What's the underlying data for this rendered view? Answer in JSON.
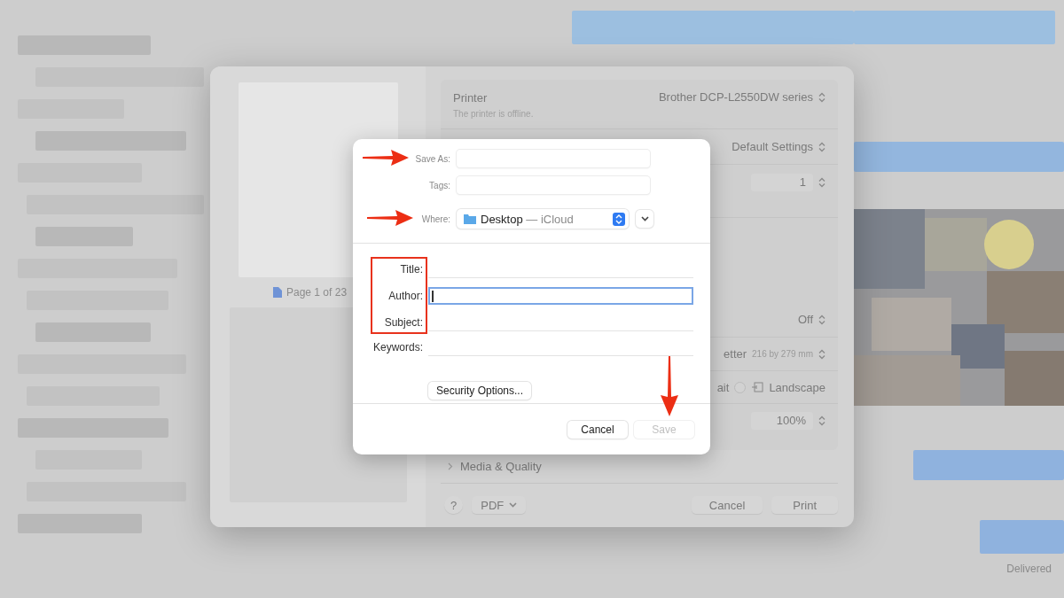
{
  "print_dialog": {
    "preview": {
      "page_label": "Page 1 of 23"
    },
    "printer": {
      "label": "Printer",
      "value": "Brother DCP-L2550DW series",
      "status": "The printer is offline."
    },
    "presets": {
      "value": "Default Settings"
    },
    "copies": {
      "value": "1"
    },
    "settings_rows": [
      {
        "kind": "popup",
        "value": "Off"
      },
      {
        "kind": "paper",
        "value": "etter",
        "detail": "216 by 279 mm"
      },
      {
        "kind": "orientation",
        "portrait_label": "ait",
        "landscape": {
          "label": "Landscape",
          "selected": false
        }
      },
      {
        "kind": "stepper",
        "value": "100%"
      }
    ],
    "section": {
      "label": "Media & Quality",
      "expanded": false
    },
    "help_button": "?",
    "pdf_button": "PDF",
    "buttons": [
      "Cancel",
      "Print"
    ]
  },
  "save_sheet": {
    "save_as": {
      "label": "Save As:"
    },
    "tags": {
      "label": "Tags:"
    },
    "where": {
      "label": "Where:",
      "folder": "Desktop",
      "location": "— iCloud"
    },
    "metadata_fields": [
      {
        "label": "Title:",
        "focused": false
      },
      {
        "label": "Author:",
        "focused": true
      },
      {
        "label": "Subject:",
        "focused": false
      },
      {
        "label": "Keywords:",
        "focused": false
      }
    ],
    "security_button": "Security Options...",
    "cancel_button": "Cancel",
    "save_button": {
      "label": "Save",
      "disabled": true
    }
  },
  "messages": {
    "status": "Delivered"
  }
}
